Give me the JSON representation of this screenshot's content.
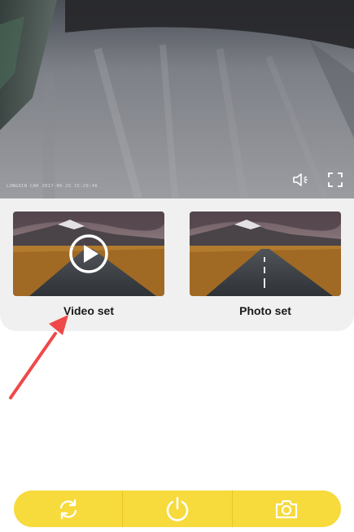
{
  "video_feed": {
    "timestamp_overlay": "LONGXIN CAR  2017-06-25 15:29:46",
    "volume_icon": "speaker-icon",
    "fullscreen_icon": "fullscreen-icon"
  },
  "modes": [
    {
      "label": "Video set",
      "icon": "play-icon"
    },
    {
      "label": "Photo set"
    }
  ],
  "control_bar": {
    "background": "#f7da3b",
    "icons": [
      "refresh-icon",
      "power-icon",
      "camera-icon"
    ]
  },
  "annotation": {
    "arrow_color": "#f04848"
  }
}
